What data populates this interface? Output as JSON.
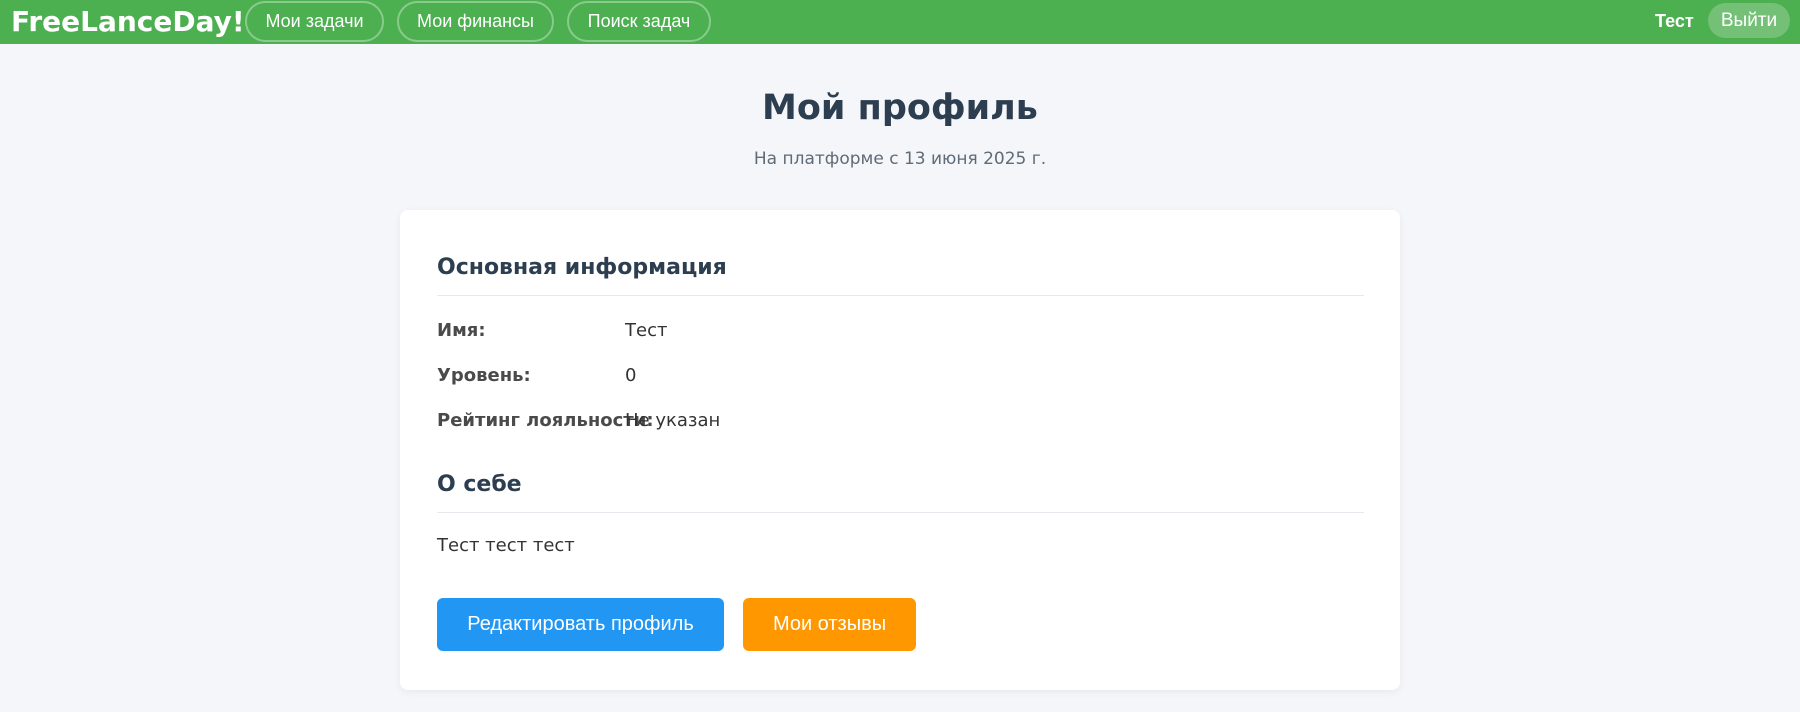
{
  "header": {
    "brand": "FreeLanceDay!",
    "nav": [
      {
        "label": "Мои задачи"
      },
      {
        "label": "Мои финансы"
      },
      {
        "label": "Поиск задач"
      }
    ],
    "user_name": "Тест",
    "logout_label": "Выйти"
  },
  "page": {
    "title": "Мой профиль",
    "subtitle": "На платформе с 13 июня 2025 г."
  },
  "profile": {
    "basic_section_title": "Основная информация",
    "rows": [
      {
        "label": "Имя:",
        "value": "Тест"
      },
      {
        "label": "Уровень:",
        "value": "0"
      },
      {
        "label": "Рейтинг лояльности:",
        "value": "Не указан"
      }
    ],
    "about_section_title": "О себе",
    "about_text": "Тест тест тест"
  },
  "actions": {
    "edit_label": "Редактировать профиль",
    "reviews_label": "Мои отзывы"
  },
  "colors": {
    "header_bg": "#4caf50",
    "edit_button": "#2196f3",
    "reviews_button": "#ff9800",
    "page_bg": "#f5f6fa"
  }
}
